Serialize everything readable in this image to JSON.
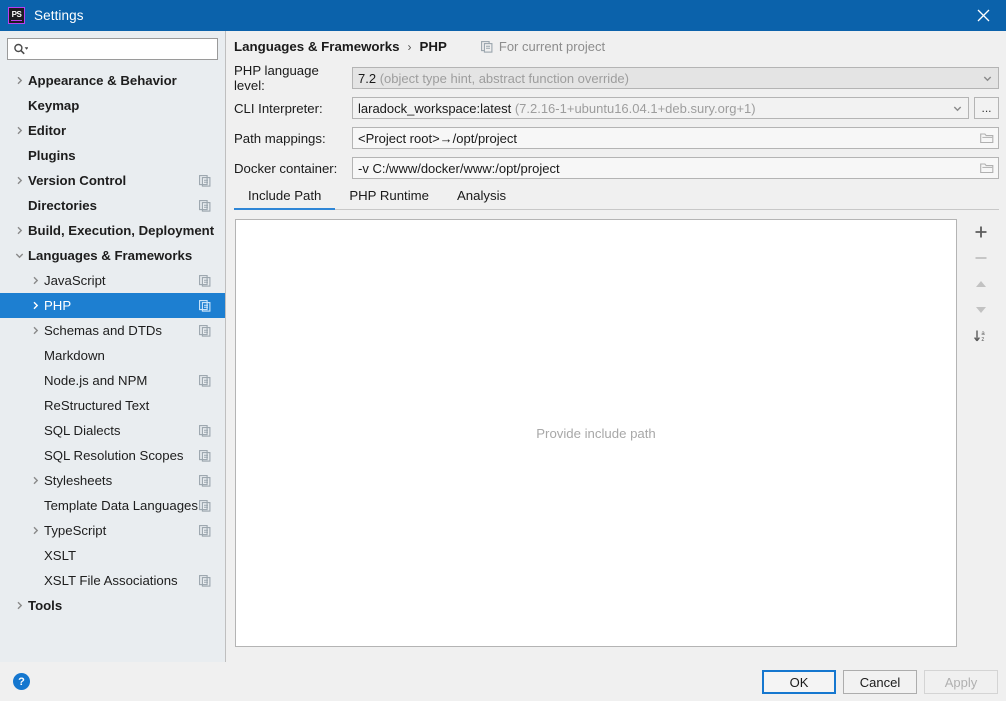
{
  "titlebar": {
    "title": "Settings",
    "app_icon": "phpstorm-icon",
    "app_icon_text": "PS",
    "close_icon": "close-icon",
    "bg_color": "#0b62ab"
  },
  "search": {
    "icon": "search-icon",
    "value": "",
    "placeholder": ""
  },
  "sidebar": {
    "items": [
      {
        "label": "Appearance & Behavior",
        "level": 0,
        "expandable": true,
        "expanded": false,
        "scoped": false,
        "selected": false
      },
      {
        "label": "Keymap",
        "level": 0,
        "expandable": false,
        "expanded": false,
        "scoped": false,
        "selected": false
      },
      {
        "label": "Editor",
        "level": 0,
        "expandable": true,
        "expanded": false,
        "scoped": false,
        "selected": false
      },
      {
        "label": "Plugins",
        "level": 0,
        "expandable": false,
        "expanded": false,
        "scoped": false,
        "selected": false
      },
      {
        "label": "Version Control",
        "level": 0,
        "expandable": true,
        "expanded": false,
        "scoped": true,
        "selected": false
      },
      {
        "label": "Directories",
        "level": 0,
        "expandable": false,
        "expanded": false,
        "scoped": true,
        "selected": false
      },
      {
        "label": "Build, Execution, Deployment",
        "level": 0,
        "expandable": true,
        "expanded": false,
        "scoped": false,
        "selected": false
      },
      {
        "label": "Languages & Frameworks",
        "level": 0,
        "expandable": true,
        "expanded": true,
        "scoped": false,
        "selected": false
      },
      {
        "label": "JavaScript",
        "level": 1,
        "expandable": true,
        "expanded": false,
        "scoped": true,
        "selected": false
      },
      {
        "label": "PHP",
        "level": 1,
        "expandable": true,
        "expanded": false,
        "scoped": true,
        "selected": true
      },
      {
        "label": "Schemas and DTDs",
        "level": 1,
        "expandable": true,
        "expanded": false,
        "scoped": true,
        "selected": false
      },
      {
        "label": "Markdown",
        "level": 1,
        "expandable": false,
        "expanded": false,
        "scoped": false,
        "selected": false
      },
      {
        "label": "Node.js and NPM",
        "level": 1,
        "expandable": false,
        "expanded": false,
        "scoped": true,
        "selected": false
      },
      {
        "label": "ReStructured Text",
        "level": 1,
        "expandable": false,
        "expanded": false,
        "scoped": false,
        "selected": false
      },
      {
        "label": "SQL Dialects",
        "level": 1,
        "expandable": false,
        "expanded": false,
        "scoped": true,
        "selected": false
      },
      {
        "label": "SQL Resolution Scopes",
        "level": 1,
        "expandable": false,
        "expanded": false,
        "scoped": true,
        "selected": false
      },
      {
        "label": "Stylesheets",
        "level": 1,
        "expandable": true,
        "expanded": false,
        "scoped": true,
        "selected": false
      },
      {
        "label": "Template Data Languages",
        "level": 1,
        "expandable": false,
        "expanded": false,
        "scoped": true,
        "selected": false
      },
      {
        "label": "TypeScript",
        "level": 1,
        "expandable": true,
        "expanded": false,
        "scoped": true,
        "selected": false
      },
      {
        "label": "XSLT",
        "level": 1,
        "expandable": false,
        "expanded": false,
        "scoped": false,
        "selected": false
      },
      {
        "label": "XSLT File Associations",
        "level": 1,
        "expandable": false,
        "expanded": false,
        "scoped": true,
        "selected": false
      },
      {
        "label": "Tools",
        "level": 0,
        "expandable": true,
        "expanded": false,
        "scoped": false,
        "selected": false
      }
    ]
  },
  "breadcrumb": {
    "parent": "Languages & Frameworks",
    "separator": "›",
    "current": "PHP",
    "scope_icon": "project-scope-icon",
    "scope_label": "For current project"
  },
  "form": {
    "rows": [
      {
        "label": "PHP language level:",
        "value": "7.2",
        "value_dim": " (object type hint, abstract function override)",
        "control": "combobox",
        "state": "disabled",
        "trailing_icon": "chevron-down-icon",
        "extra_button": null
      },
      {
        "label": "CLI Interpreter:",
        "value": "laradock_workspace:latest",
        "value_dim": " (7.2.16-1+ubuntu16.04.1+deb.sury.org+1)",
        "control": "combobox",
        "state": "readonly",
        "trailing_icon": "chevron-down-icon",
        "extra_button": "..."
      },
      {
        "label": "Path mappings:",
        "value": "<Project root>→/opt/project",
        "value_dim": "",
        "control": "text",
        "state": "plain",
        "trailing_icon": "folder-icon",
        "extra_button": null
      },
      {
        "label": "Docker container:",
        "value": "-v C:/www/docker/www:/opt/project",
        "value_dim": "",
        "control": "text",
        "state": "plain",
        "trailing_icon": "folder-icon",
        "extra_button": null
      }
    ]
  },
  "tabs": {
    "items": [
      {
        "label": "Include Path",
        "active": true
      },
      {
        "label": "PHP Runtime",
        "active": false
      },
      {
        "label": "Analysis",
        "active": false
      }
    ],
    "active_underline_color": "#2f86d6"
  },
  "include_path_panel": {
    "empty_message": "Provide include path",
    "rows": []
  },
  "panel_toolbar": {
    "buttons": [
      {
        "name": "add-button",
        "icon": "plus-icon",
        "enabled": true
      },
      {
        "name": "remove-button",
        "icon": "minus-icon",
        "enabled": false
      },
      {
        "name": "move-up-button",
        "icon": "arrow-up-icon",
        "enabled": false
      },
      {
        "name": "move-down-button",
        "icon": "arrow-down-icon",
        "enabled": false
      },
      {
        "name": "sort-button",
        "icon": "sort-alpha-icon",
        "enabled": true
      }
    ]
  },
  "footer": {
    "help_icon": "help-icon",
    "help_glyph": "?",
    "ok_label": "OK",
    "cancel_label": "Cancel",
    "apply_label": "Apply",
    "apply_enabled": false,
    "default_button_color": "#1577cf"
  }
}
